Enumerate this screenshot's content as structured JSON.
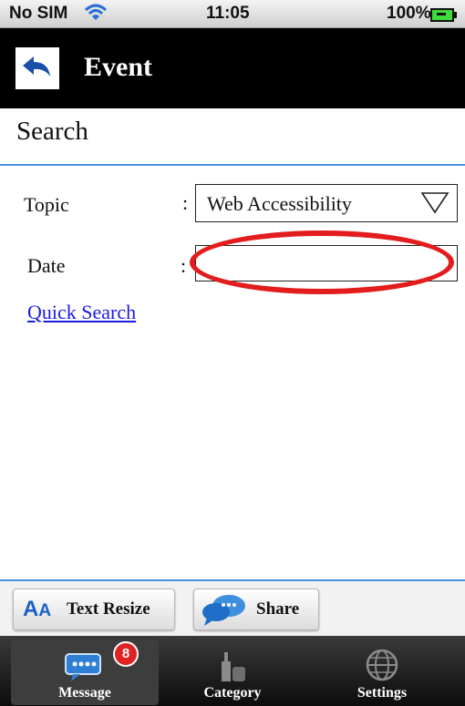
{
  "status_bar": {
    "carrier": "No SIM",
    "time": "11:05",
    "battery": "100%"
  },
  "header": {
    "title": "Event",
    "back_icon": "back-arrow-icon"
  },
  "search": {
    "title": "Search",
    "topic_label": "Topic",
    "topic_colon": ":",
    "topic_value": "Web Accessibility",
    "date_label": "Date",
    "date_colon": ":",
    "date_value": "",
    "quick_search": "Quick Search"
  },
  "toolbar": {
    "text_resize": "Text Resize",
    "share": "Share"
  },
  "tabs": [
    {
      "label": "Message",
      "icon": "message-bubble-icon",
      "badge": "8",
      "selected": true
    },
    {
      "label": "Category",
      "icon": "building-icon",
      "selected": false
    },
    {
      "label": "Settings",
      "icon": "globe-icon",
      "selected": false
    }
  ],
  "colors": {
    "accent_line": "#4a90d9",
    "link": "#1a1ae6",
    "highlight": "#e31d1d",
    "title_bar": "#000000"
  }
}
